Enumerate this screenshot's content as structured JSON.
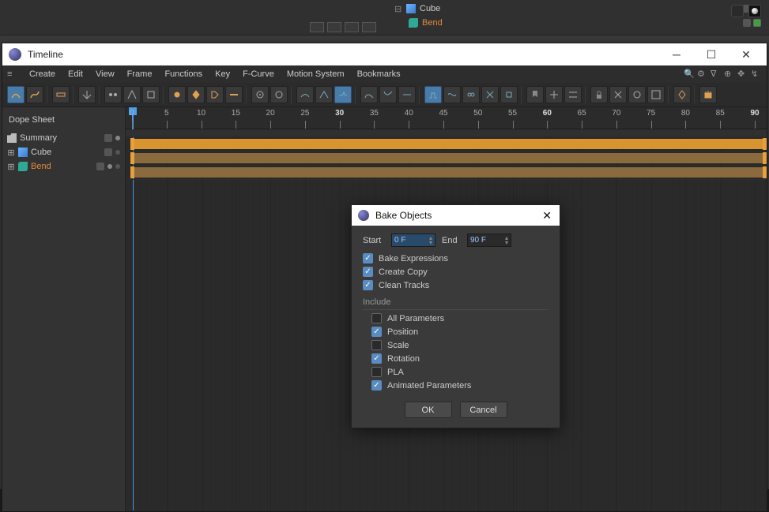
{
  "object_manager": {
    "items": [
      {
        "name": "Cube",
        "color": "default"
      },
      {
        "name": "Bend",
        "color": "orange"
      }
    ]
  },
  "timeline": {
    "window_title": "Timeline",
    "menus": [
      "Create",
      "Edit",
      "View",
      "Frame",
      "Functions",
      "Key",
      "F-Curve",
      "Motion System",
      "Bookmarks"
    ],
    "section_label": "Dope Sheet",
    "ruler": {
      "start": 0,
      "end": 90,
      "step": 5,
      "highlight": [
        30,
        60,
        90
      ]
    },
    "hierarchy": [
      {
        "label": "Summary",
        "icon": "folder",
        "orange": false
      },
      {
        "label": "Cube",
        "icon": "cube",
        "orange": false
      },
      {
        "label": "Bend",
        "icon": "bend",
        "orange": true
      }
    ]
  },
  "modal": {
    "title": "Bake Objects",
    "start_label": "Start",
    "start_value": "0 F",
    "end_label": "End",
    "end_value": "90 F",
    "options": [
      {
        "label": "Bake Expressions",
        "checked": true
      },
      {
        "label": "Create Copy",
        "checked": true
      },
      {
        "label": "Clean Tracks",
        "checked": true
      }
    ],
    "include_label": "Include",
    "include": [
      {
        "label": "All Parameters",
        "checked": false
      },
      {
        "label": "Position",
        "checked": true
      },
      {
        "label": "Scale",
        "checked": false
      },
      {
        "label": "Rotation",
        "checked": true
      },
      {
        "label": "PLA",
        "checked": false
      },
      {
        "label": "Animated Parameters",
        "checked": true
      }
    ],
    "ok_label": "OK",
    "cancel_label": "Cancel"
  }
}
